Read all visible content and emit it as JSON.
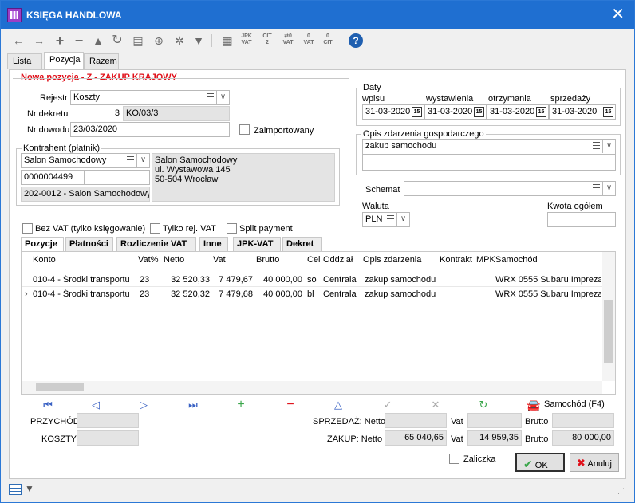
{
  "window": {
    "title": "KSIĘGA HANDLOWA"
  },
  "colors": {
    "titlebar": "#1f6fd1",
    "title_red": "#e0101a",
    "add_green": "#3aa64a",
    "remove_red": "#e0101a",
    "nav_blue": "#3a62c4",
    "car_blue": "#1f5fb0"
  },
  "toolbar": {
    "icons": [
      "arrow-left-icon",
      "arrow-right-icon",
      "plus-icon",
      "minus-icon",
      "triangle-icon",
      "refresh-icon",
      "print-icon",
      "zoom-icon",
      "settings-icon",
      "filter-icon",
      "barcode-icon",
      "jpk-vat-icon",
      "cit2-icon",
      "import-vat-icon",
      "vat-icon",
      "cit-icon",
      "help-icon"
    ],
    "small_labels": {
      "jpk": "JPK\nVAT",
      "cit2": "CIT\n2",
      "imp": "⇄0\nVAT",
      "vat": "0\nVAT",
      "cit": "0\nCIT"
    }
  },
  "tabs": [
    "Lista",
    "Pozycja",
    "Razem"
  ],
  "form": {
    "title": "Nowa pozycja - Z - ZAKUP KRAJOWY",
    "rejestr_label": "Rejestr",
    "rejestr_value": "Koszty",
    "nr_dekretu_label": "Nr dekretu",
    "nr_dekretu_num": "3",
    "nr_dekretu_symbol": "KO/03/3",
    "nr_dowodu_label": "Nr dowodu",
    "nr_dowodu_value": "23/03/2020",
    "zaimportowany_label": "Zaimportowany",
    "kontrahent_label": "Kontrahent (płatnik)",
    "kontrahent_name": "Salon Samochodowy",
    "kontrahent_code": "0000004499",
    "kontrahent_account": "202-0012 - Salon Samochodowy",
    "address_line1": "Salon Samochodowy",
    "address_line2": "ul. Wystawowa 145",
    "address_line3": "50-504 Wrocław",
    "daty_label": "Daty",
    "wpisu_label": "wpisu",
    "wpisu_value": "31-03-2020",
    "wystawienia_label": "wystawienia",
    "wystawienia_value": "31-03-2020",
    "otrzymania_label": "otrzymania",
    "otrzymania_value": "31-03-2020",
    "sprzedazy_label": "sprzedaży",
    "sprzedazy_value": "31-03-2020",
    "calendar_glyph": "15",
    "opis_label": "Opis zdarzenia gospodarczego",
    "opis_value": "zakup samochodu",
    "schemat_label": "Schemat",
    "waluta_label": "Waluta",
    "waluta_value": "PLN",
    "kwota_label": "Kwota ogółem",
    "bez_vat_label": "Bez VAT (tylko księgowanie)",
    "tylko_rej_label": "Tylko rej. VAT",
    "split_label": "Split payment"
  },
  "subtabs": [
    "Pozycje",
    "Płatności",
    "Rozliczenie VAT",
    "Inne",
    "JPK-VAT",
    "Dekret"
  ],
  "grid": {
    "headers": [
      "Konto",
      "Vat%",
      "Netto",
      "Vat",
      "Brutto",
      "Cel",
      "Oddział",
      "Opis zdarzenia",
      "Kontrakt",
      "MPK",
      "Samochód"
    ],
    "rows": [
      [
        "010-4 - Środki transportu",
        "23",
        "32 520,33",
        "7 479,67",
        "40 000,00",
        "so",
        "Centrala",
        "zakup samochodu",
        "",
        "",
        "WRX 0555 Subaru Impreza"
      ],
      [
        "010-4 - Środki transportu",
        "23",
        "32 520,32",
        "7 479,68",
        "40 000,00",
        "bl",
        "Centrala",
        "zakup samochodu",
        "",
        "",
        "WRX 0555 Subaru Impreza"
      ]
    ]
  },
  "summary": {
    "samochod_label": "Samochód (F4)",
    "przychod_label": "PRZYCHÓD",
    "koszty_label": "KOSZTY",
    "sprzedaz_label": "SPRZEDAŻ: Netto",
    "zakup_label": "ZAKUP: Netto",
    "vat_label": "Vat",
    "brutto_label": "Brutto",
    "zakup_netto": "65 040,65",
    "zakup_vat": "14 959,35",
    "zakup_brutto": "80 000,00"
  },
  "footer": {
    "zaliczka_label": "Zaliczka",
    "ok_label": "OK",
    "anuluj_label": "Anuluj"
  }
}
